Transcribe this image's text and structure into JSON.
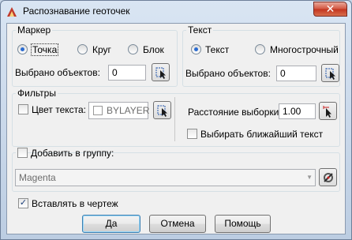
{
  "window": {
    "title": "Распознавание геоточек",
    "close_glyph": "✕"
  },
  "marker": {
    "label": "Маркер",
    "options": [
      {
        "label": "Точка",
        "checked": true
      },
      {
        "label": "Круг",
        "checked": false
      },
      {
        "label": "Блок",
        "checked": false
      }
    ],
    "selected_label": "Выбрано объектов:",
    "selected_value": "0"
  },
  "text": {
    "label": "Текст",
    "options": [
      {
        "label": "Текст",
        "checked": true
      },
      {
        "label": "Многострочный",
        "checked": false
      }
    ],
    "selected_label": "Выбрано объектов:",
    "selected_value": "0"
  },
  "filters": {
    "label": "Фильтры",
    "text_color_label": "Цвет текста:",
    "text_color_checked": false,
    "color_value": "BYLAYER",
    "distance_label": "Расстояние выборки:",
    "distance_value": "1.00",
    "nearest_label": "Выбирать ближайший текст",
    "nearest_checked": false
  },
  "group": {
    "add_label": "Добавить в группу:",
    "add_checked": false,
    "combo_value": "Magenta"
  },
  "insert": {
    "label": "Вставлять в чертеж",
    "checked": true
  },
  "buttons": {
    "ok": "Да",
    "cancel": "Отмена",
    "help": "Помощь"
  },
  "colors": {
    "radio_dot": "#2a6bd0",
    "close_red": "#c2331e",
    "disabled_text": "#6d6d6d"
  },
  "icons": [
    "app-icon",
    "close-icon",
    "pick-objects-icon",
    "pick-distance-icon",
    "group-edit-icon",
    "combo-arrow-icon"
  ]
}
